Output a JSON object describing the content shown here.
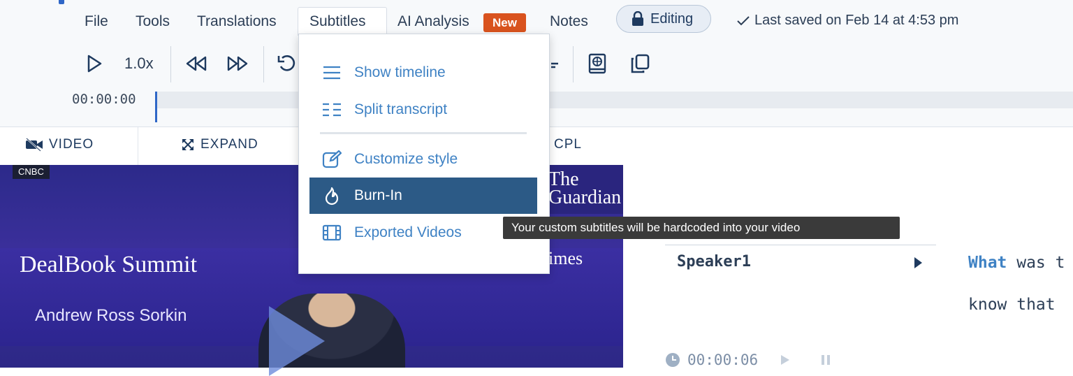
{
  "menu": {
    "file": "File",
    "tools": "Tools",
    "translations": "Translations",
    "subtitles": "Subtitles",
    "ai_analysis": "AI Analysis",
    "new_badge": "New",
    "notes": "Notes",
    "editing": "Editing",
    "saved": "Last saved on Feb 14 at 4:53 pm"
  },
  "toolbar": {
    "speed": "1.0x",
    "timecode": "00:00:00"
  },
  "panel": {
    "video": "VIDEO",
    "expand": "EXPAND",
    "cpl": "CPL"
  },
  "video": {
    "network": "CNBC",
    "guardian": "The Guardian",
    "event": "DealBook Summit",
    "speaker_name": "Andrew Ross Sorkin",
    "times": "imes"
  },
  "dropdown": {
    "items": [
      {
        "label": "Show timeline",
        "icon": "lines-icon"
      },
      {
        "label": "Split transcript",
        "icon": "split-list-icon"
      },
      {
        "label": "Customize style",
        "icon": "edit-icon"
      },
      {
        "label": "Burn-In",
        "icon": "flame-icon"
      },
      {
        "label": "Exported Videos",
        "icon": "film-icon"
      }
    ],
    "active": "Burn-In"
  },
  "tooltip": "Your custom subtitles will be hardcoded into your video",
  "transcript": {
    "speaker": "Speaker1",
    "line1_highlight": "What",
    "line1_rest": " was t",
    "line2": "know that",
    "time2": "00:00:06"
  },
  "colors": {
    "accent": "#3f82c4",
    "active_item": "#2c5a86",
    "badge": "#d9531e"
  }
}
